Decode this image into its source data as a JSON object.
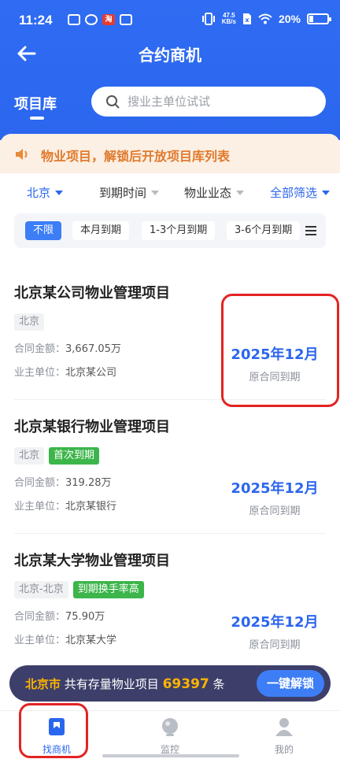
{
  "status_bar": {
    "time": "11:24",
    "app_badge": "淘",
    "net_speed": "47.5",
    "net_unit": "KB/s",
    "battery": "20%"
  },
  "header": {
    "title": "合约商机",
    "tab_label": "项目库",
    "search_placeholder": "搜业主单位试试"
  },
  "notice": {
    "text": "物业项目，解锁后开放项目库列表"
  },
  "filters": [
    {
      "label": "北京",
      "active": true
    },
    {
      "label": "到期时间",
      "active": false
    },
    {
      "label": "物业业态",
      "active": false
    },
    {
      "label": "全部筛选",
      "active": true
    }
  ],
  "chips": [
    {
      "label": "不限",
      "active": true
    },
    {
      "label": "本月到期",
      "active": false
    },
    {
      "label": "1-3个月到期",
      "active": false
    },
    {
      "label": "3-6个月到期",
      "active": false
    }
  ],
  "labels": {
    "contract_amount": "合同金额：",
    "owner_unit": "业主单位："
  },
  "projects": [
    {
      "title": "北京某公司物业管理项目",
      "tags": [
        {
          "text": "北京",
          "style": "gray"
        }
      ],
      "amount": "3,667.05万",
      "owner": "北京某公司",
      "due_date": "2025年12月",
      "due_label": "原合同到期"
    },
    {
      "title": "北京某银行物业管理项目",
      "tags": [
        {
          "text": "北京",
          "style": "gray"
        },
        {
          "text": "首次到期",
          "style": "green"
        }
      ],
      "amount": "319.28万",
      "owner": "北京某银行",
      "due_date": "2025年12月",
      "due_label": "原合同到期"
    },
    {
      "title": "北京某大学物业管理项目",
      "tags": [
        {
          "text": "北京-北京",
          "style": "gray"
        },
        {
          "text": "到期换手率高",
          "style": "green"
        }
      ],
      "amount": "75.90万",
      "owner": "北京某大学",
      "due_date": "2025年12月",
      "due_label": "原合同到期"
    }
  ],
  "banner": {
    "city": "北京市",
    "text_before": "共有存量物业项目",
    "count": "69397",
    "text_after": "条",
    "button": "一键解锁"
  },
  "bottom_nav": [
    {
      "label": "找商机",
      "icon": "bookmark-icon",
      "active": true
    },
    {
      "label": "监控",
      "icon": "monitor-icon",
      "active": false
    },
    {
      "label": "我的",
      "icon": "person-icon",
      "active": false
    }
  ],
  "colors": {
    "primary": "#2b66ee",
    "notice_bg": "#fcefe3",
    "notice_text": "#e07a2c",
    "tag_green": "#3cb54a",
    "banner_bg": "#3d3f6a",
    "banner_highlight": "#ffb400",
    "annotation_red": "#e32323"
  }
}
